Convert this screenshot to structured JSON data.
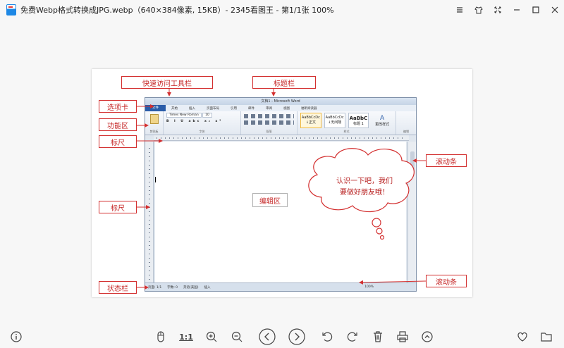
{
  "window": {
    "title": "免费Webp格式转换成JPG.webp（640×384像素, 15KB）- 2345看图王 - 第1/1张 100%"
  },
  "window_buttons": [
    "menu-icon",
    "skin-icon",
    "fullscreen-icon",
    "minimize-icon",
    "maximize-icon",
    "close-icon"
  ],
  "image": {
    "labels": {
      "quick_access": "快速访问工具栏",
      "title_bar": "标题栏",
      "tabs": "选项卡",
      "ribbon": "功能区",
      "ruler_top": "标尺",
      "ruler_left": "标尺",
      "scroll_right": "滚动条",
      "scroll_bottom": "滚动条",
      "status_bar": "状态栏",
      "edit_area": "编辑区"
    },
    "bubble_line1": "认识一下吧，我们",
    "bubble_line2": "要做好朋友哦！",
    "word": {
      "title": "文档1 - Microsoft Word",
      "tabs": [
        "文件",
        "开始",
        "插入",
        "页面布局",
        "引用",
        "邮件",
        "审阅",
        "视图",
        "福昕阅读器"
      ],
      "font_name": "Times New Roman",
      "font_size": "10",
      "styles": [
        "AaBbCcDc",
        "AaBbCcDc",
        "AaBbC",
        "A"
      ],
      "style_names": [
        "↓正文",
        "↓无间隔",
        "标题 1",
        "更改样式"
      ],
      "groups": [
        "剪贴板",
        "字体",
        "段落",
        "样式",
        "编辑"
      ],
      "status_page": "页面: 1/1",
      "status_words": "字数: 0",
      "status_lang": "英语(美国)",
      "status_mode": "插入",
      "zoom": "100%"
    }
  },
  "toolbar": {
    "ratio_label": "1:1"
  }
}
